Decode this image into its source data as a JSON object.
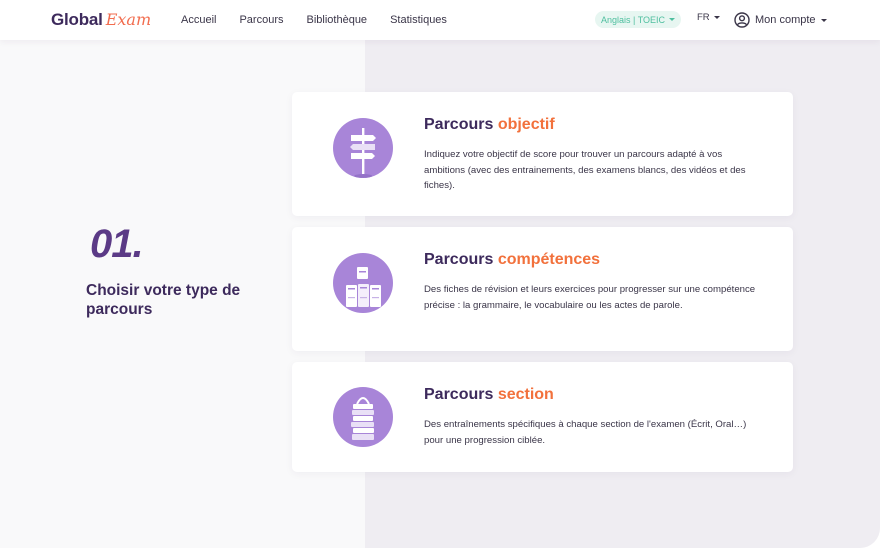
{
  "brand": {
    "part1": "Global",
    "part2": "Exam"
  },
  "nav": {
    "items": [
      {
        "label": "Accueil"
      },
      {
        "label": "Parcours"
      },
      {
        "label": "Bibliothèque"
      },
      {
        "label": "Statistiques"
      }
    ]
  },
  "header": {
    "exam_selector": "Anglais | TOEIC",
    "language": "FR",
    "account": "Mon compte"
  },
  "step": {
    "number": "01.",
    "title": "Choisir votre type de parcours"
  },
  "cards": [
    {
      "title_prefix": "Parcours ",
      "title_highlight": "objectif",
      "description": "Indiquez votre objectif de score pour trouver un parcours adapté à vos ambitions (avec des entrainements, des examens blancs, des vidéos et des fiches).",
      "icon": "signpost-icon"
    },
    {
      "title_prefix": "Parcours ",
      "title_highlight": "compétences",
      "description": "Des fiches de révision et leurs exercices pour progresser sur une compétence précise : la grammaire, le vocabulaire ou les actes de parole.",
      "icon": "cards-icon"
    },
    {
      "title_prefix": "Parcours ",
      "title_highlight": "section",
      "description": "Des entraînements spécifiques à chaque section de l'examen (Écrit, Oral…) pour une progression ciblée.",
      "icon": "book-stack-icon"
    }
  ],
  "colors": {
    "brand_dark": "#3d2a5c",
    "accent_orange": "#f2713c",
    "illustration_bg": "#a885d8",
    "exam_pill_text": "#4fbf9f"
  }
}
